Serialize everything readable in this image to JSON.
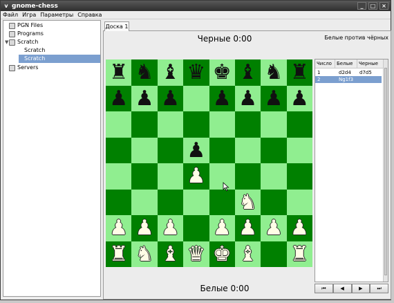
{
  "window": {
    "title": "gnome-chess",
    "menu_glyph": "v",
    "controls": [
      "_",
      "□",
      "×"
    ]
  },
  "menu": {
    "items": [
      {
        "label": "Файл",
        "accel": "Ф"
      },
      {
        "label": "Игра",
        "accel": "И"
      },
      {
        "label": "Параметры",
        "accel": "П"
      },
      {
        "label": "Справка",
        "accel": "С"
      }
    ]
  },
  "sidebar": {
    "items": [
      {
        "label": "PGN Files",
        "icon": "pgn-files-icon",
        "level": 0,
        "selected": false
      },
      {
        "label": "Programs",
        "icon": "programs-icon",
        "level": 0,
        "selected": false
      },
      {
        "label": "Scratch",
        "icon": "scratch-icon",
        "level": 0,
        "selected": false,
        "expanded": true
      },
      {
        "label": "Scratch",
        "icon": "",
        "level": 1,
        "selected": false
      },
      {
        "label": "Scratch",
        "icon": "",
        "level": 1,
        "selected": true
      },
      {
        "label": "Servers",
        "icon": "servers-icon",
        "level": 0,
        "selected": false
      }
    ]
  },
  "tab": {
    "label": "Доска 1"
  },
  "game": {
    "black_timer": "Черные  0:00",
    "white_timer": "Белые  0:00",
    "description": "Белые против чёрных"
  },
  "board": {
    "light_color": "#90ee90",
    "dark_color": "#008000",
    "rows": [
      [
        "r",
        "n",
        "b",
        "q",
        "k",
        "b",
        "n",
        "r"
      ],
      [
        "p",
        "p",
        "p",
        "",
        "p",
        "p",
        "p",
        "p"
      ],
      [
        "",
        "",
        "",
        "",
        "",
        "",
        "",
        ""
      ],
      [
        "",
        "",
        "",
        "p",
        "",
        "",
        "",
        ""
      ],
      [
        "",
        "",
        "",
        "P",
        "",
        "",
        "",
        ""
      ],
      [
        "",
        "",
        "",
        "",
        "",
        "N",
        "",
        ""
      ],
      [
        "P",
        "P",
        "P",
        "",
        "P",
        "P",
        "P",
        "P"
      ],
      [
        "R",
        "N",
        "B",
        "Q",
        "K",
        "B",
        "",
        "R"
      ]
    ]
  },
  "moves": {
    "headers": [
      "Число",
      "Белые",
      "Черные"
    ],
    "rows": [
      {
        "num": "1",
        "white": "d2d4",
        "black": "d7d5",
        "selected": false
      },
      {
        "num": "2",
        "white": "Ng1f3",
        "black": "",
        "selected": true
      }
    ]
  },
  "nav": {
    "first": "⏮",
    "prev": "◀",
    "next": "▶",
    "last": "⏭"
  }
}
